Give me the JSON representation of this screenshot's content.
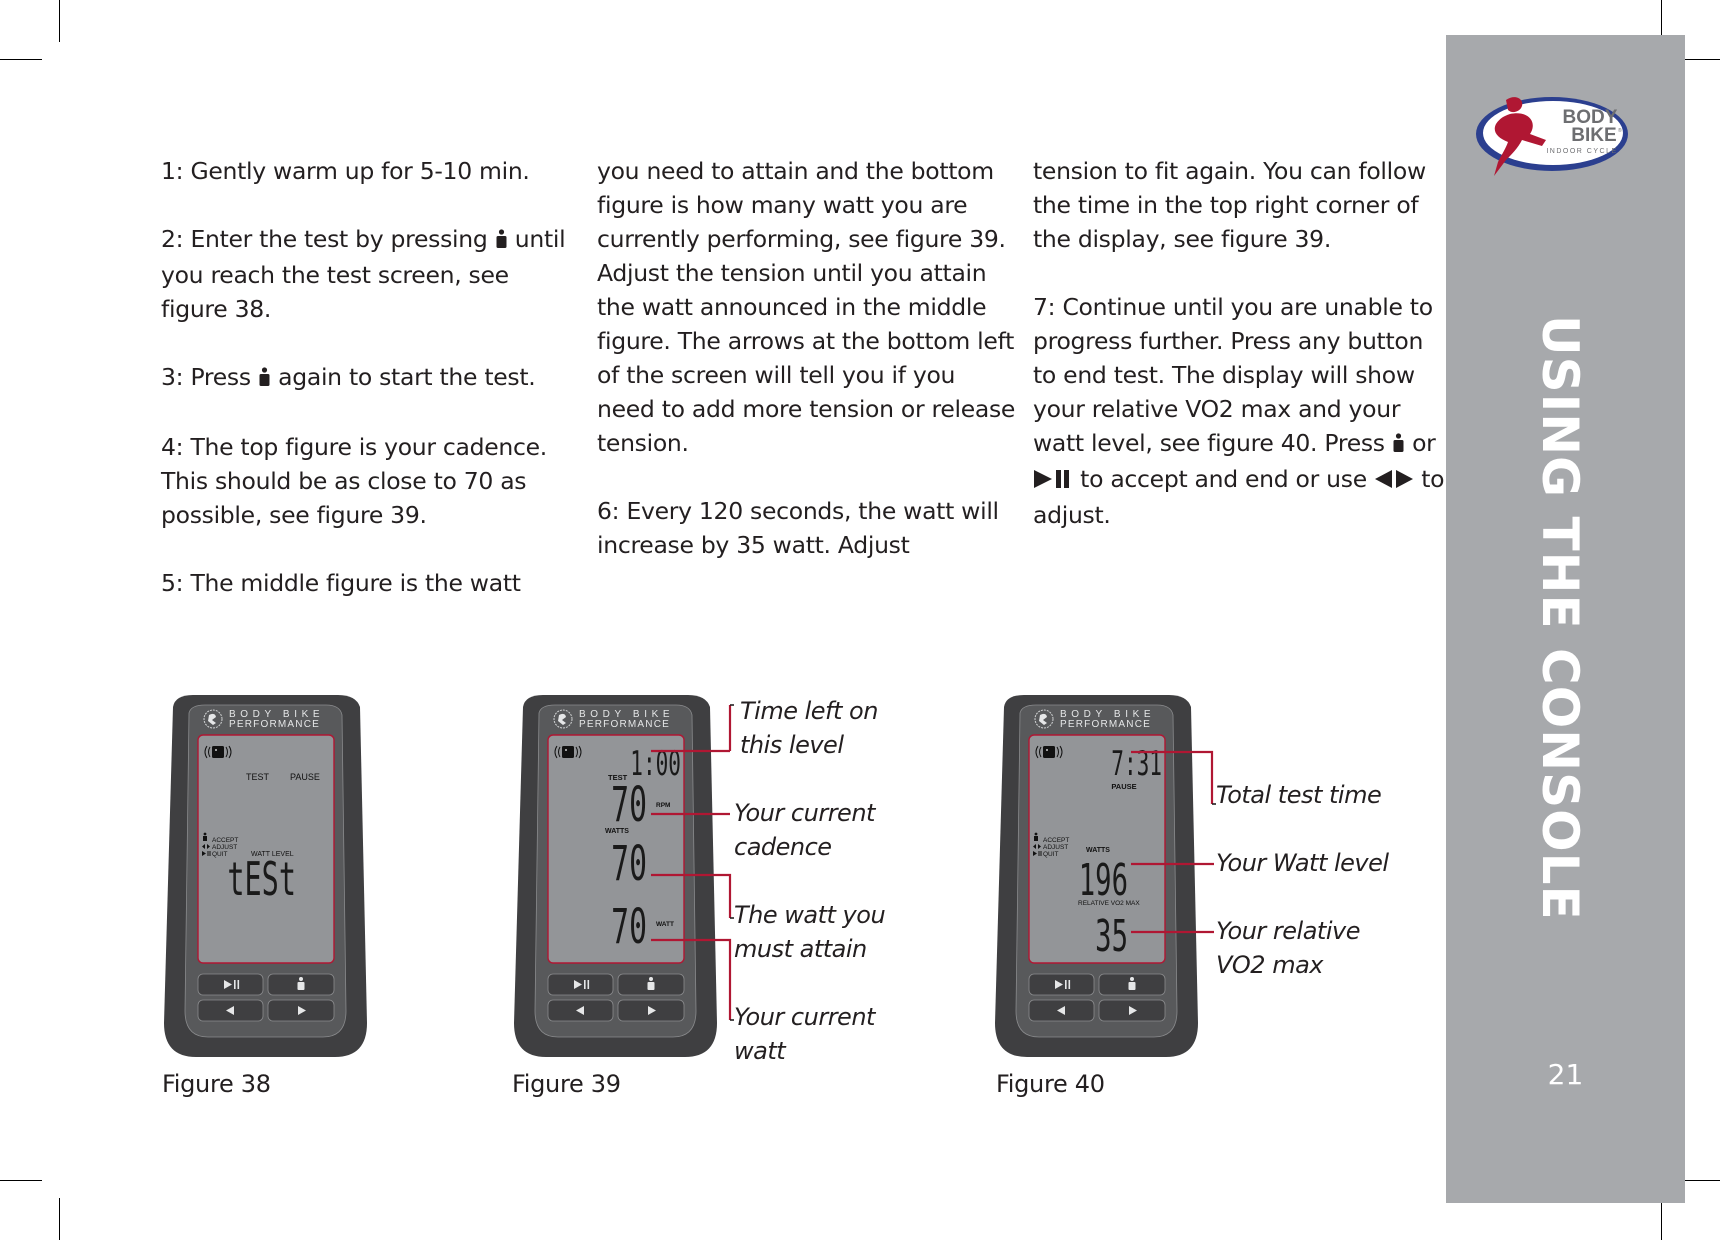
{
  "sidebar": {
    "section_title": "USING THE CONSOLE",
    "page_number": "21",
    "logo": {
      "line1": "BODY",
      "line2": "BIKE",
      "tagline": "INDOOR CYCLE",
      "registered": "®"
    },
    "band_color": "#a7a9ac",
    "accent_red": "#b01733",
    "accent_blue": "#2b3f8f"
  },
  "columns": [
    {
      "paragraphs": [
        {
          "parts": [
            "1: Gently warm up for 5-10 min."
          ]
        },
        {
          "parts": [
            "2: Enter the test by pressing ",
            "{person-icon}",
            " until you reach the test screen, see figure 38."
          ]
        },
        {
          "parts": [
            "3: Press ",
            "{person-icon}",
            " again to start the test."
          ]
        },
        {
          "parts": [
            "4: The top figure is your cadence. This should be as close to 70 as possible, see figure 39."
          ]
        },
        {
          "parts": [
            "5: The middle figure is the watt"
          ]
        }
      ]
    },
    {
      "paragraphs": [
        {
          "parts": [
            "you need to attain and the bottom figure is how many watt you are currently performing, see figure 39.  Adjust the tension until you attain the watt announced in the middle figure. The arrows at the bottom left of the screen will tell you if you need to add more tension or release tension."
          ]
        },
        {
          "parts": [
            "6: Every 120 seconds, the watt will increase by 35 watt. Adjust"
          ]
        }
      ]
    },
    {
      "paragraphs": [
        {
          "parts": [
            "tension to fit again. You can follow the time in the top right corner of the display, see figure 39."
          ]
        },
        {
          "parts": [
            "7: Continue until you are unable to progress further. Press any button to end test. The display will show your relative VO2 max and your watt level, see figure 40. Press ",
            "{person-icon}",
            " or ",
            "{play-pause-icon}",
            " to accept and end or use ",
            "{left-right-icon}",
            " to adjust."
          ]
        }
      ]
    }
  ],
  "console_common": {
    "brand_line1": "BODY BIKE",
    "brand_line2": "PERFORMANCE",
    "buttons": [
      {
        "icon": "play-pause-icon"
      },
      {
        "icon": "person-icon"
      },
      {
        "icon": "left-arrow-icon"
      },
      {
        "icon": "right-arrow-icon"
      }
    ],
    "legend": {
      "accept": "ACCEPT",
      "adjust": "ADJUST",
      "quit": "QUIT"
    }
  },
  "figures": [
    {
      "caption": "Figure 38",
      "lcd": {
        "top_labels": [
          "TEST",
          "PAUSE"
        ],
        "watt_level_label": "WATT LEVEL",
        "main_readout": "tESt"
      }
    },
    {
      "caption": "Figure 39",
      "lcd": {
        "timer": "1:00",
        "mode_label": "TEST",
        "cadence": "70",
        "cadence_unit": "RPM",
        "target_label": "WATTS",
        "target_watt": "70",
        "current_watt": "70",
        "watt_unit": "WATT"
      },
      "callouts": [
        "Time left on this level",
        "Your current cadence",
        "The watt you must attain",
        "Your current watt"
      ]
    },
    {
      "caption": "Figure 40",
      "lcd": {
        "timer": "7:31",
        "status_label": "PAUSE",
        "watt_label": "WATTS",
        "watt_level": "196",
        "vo2_label": "RELATIVE VO2 MAX",
        "vo2_value": "35"
      },
      "callouts": [
        "Total test time",
        "Your Watt level",
        "Your relative VO2 max"
      ]
    }
  ]
}
